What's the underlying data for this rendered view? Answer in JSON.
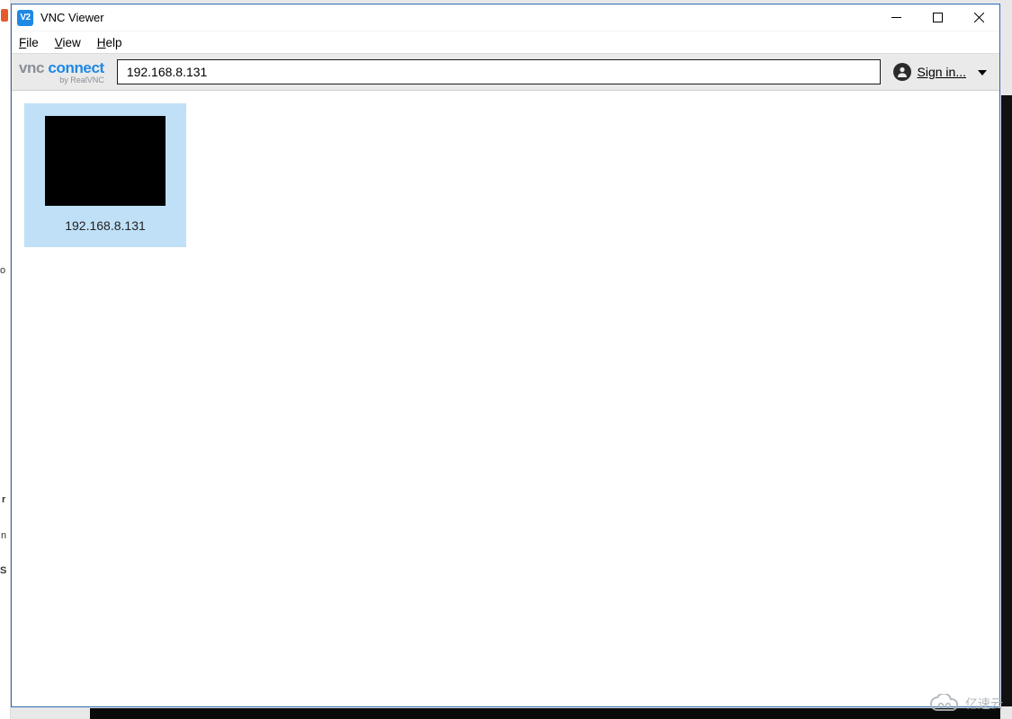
{
  "window": {
    "title": "VNC Viewer",
    "app_icon_text": "V2"
  },
  "menu": {
    "file": "File",
    "view": "View",
    "help": "Help"
  },
  "toolbar": {
    "logo_line1_vnc": "vnc",
    "logo_line1_connect": "connect",
    "logo_line2": "by RealVNC",
    "address_value": "192.168.8.131",
    "signin_label": "Sign in..."
  },
  "connections": [
    {
      "label": "192.168.8.131"
    }
  ],
  "watermark": {
    "text": "亿速云"
  }
}
